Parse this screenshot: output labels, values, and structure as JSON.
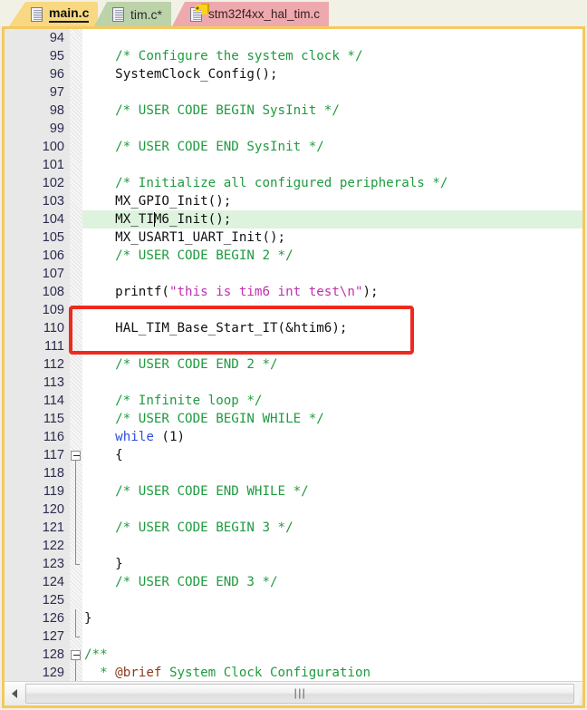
{
  "window": {
    "accent_border": "#f5c960",
    "background": "#ffffff"
  },
  "tabs": [
    {
      "label": "main.c",
      "icon": "document-icon",
      "state": "active",
      "color": "#f8d880",
      "modified": false
    },
    {
      "label": "tim.c*",
      "icon": "document-icon",
      "state": "modified",
      "color": "#bcd3aa",
      "modified": true
    },
    {
      "label": "stm32f4xx_hal_tim.c",
      "icon": "document-locked-icon",
      "state": "read-only",
      "color": "#eda9ae",
      "modified": false
    }
  ],
  "editor": {
    "language": "c",
    "current_line": 104,
    "caret_line": 104,
    "caret_column": 8,
    "first_visible_line": 94,
    "last_visible_line": 129,
    "highlight_color": "#ddf3dd",
    "annotation": {
      "type": "red-rectangle",
      "color": "#ee2a1e",
      "covers_lines": [
        109,
        110,
        111
      ]
    },
    "lines": [
      {
        "num": "94",
        "text": "",
        "fold": "none"
      },
      {
        "num": "95",
        "text": "    /* Configure the system clock */",
        "fold": "none"
      },
      {
        "num": "96",
        "text": "    SystemClock_Config();",
        "fold": "none"
      },
      {
        "num": "97",
        "text": "",
        "fold": "none"
      },
      {
        "num": "98",
        "text": "    /* USER CODE BEGIN SysInit */",
        "fold": "none"
      },
      {
        "num": "99",
        "text": "",
        "fold": "none"
      },
      {
        "num": "100",
        "text": "    /* USER CODE END SysInit */",
        "fold": "none"
      },
      {
        "num": "101",
        "text": "",
        "fold": "none"
      },
      {
        "num": "102",
        "text": "    /* Initialize all configured peripherals */",
        "fold": "none"
      },
      {
        "num": "103",
        "text": "    MX_GPIO_Init();",
        "fold": "none"
      },
      {
        "num": "104",
        "text": "    MX_TIM6_Init();",
        "fold": "none"
      },
      {
        "num": "105",
        "text": "    MX_USART1_UART_Init();",
        "fold": "none"
      },
      {
        "num": "106",
        "text": "    /* USER CODE BEGIN 2 */",
        "fold": "none"
      },
      {
        "num": "107",
        "text": "",
        "fold": "none"
      },
      {
        "num": "108",
        "text": "    printf(\"this is tim6 int test\\n\");",
        "fold": "none"
      },
      {
        "num": "109",
        "text": "",
        "fold": "none"
      },
      {
        "num": "110",
        "text": "    HAL_TIM_Base_Start_IT(&htim6);",
        "fold": "none"
      },
      {
        "num": "111",
        "text": "",
        "fold": "none"
      },
      {
        "num": "112",
        "text": "    /* USER CODE END 2 */",
        "fold": "none"
      },
      {
        "num": "113",
        "text": "",
        "fold": "none"
      },
      {
        "num": "114",
        "text": "    /* Infinite loop */",
        "fold": "none"
      },
      {
        "num": "115",
        "text": "    /* USER CODE BEGIN WHILE */",
        "fold": "none"
      },
      {
        "num": "116",
        "text": "    while (1)",
        "fold": "none"
      },
      {
        "num": "117",
        "text": "    {",
        "fold": "start"
      },
      {
        "num": "118",
        "text": "",
        "fold": "line"
      },
      {
        "num": "119",
        "text": "    /* USER CODE END WHILE */",
        "fold": "line"
      },
      {
        "num": "120",
        "text": "",
        "fold": "line"
      },
      {
        "num": "121",
        "text": "    /* USER CODE BEGIN 3 */",
        "fold": "line"
      },
      {
        "num": "122",
        "text": "",
        "fold": "line"
      },
      {
        "num": "123",
        "text": "    }",
        "fold": "end"
      },
      {
        "num": "124",
        "text": "    /* USER CODE END 3 */",
        "fold": "none"
      },
      {
        "num": "125",
        "text": "",
        "fold": "none"
      },
      {
        "num": "126",
        "text": "}",
        "fold": "line2"
      },
      {
        "num": "127",
        "text": "",
        "fold": "end2"
      },
      {
        "num": "128",
        "text": "/**",
        "fold": "start"
      },
      {
        "num": "129",
        "text": "  * @brief System Clock Configuration",
        "fold": "line"
      }
    ]
  },
  "scrollbar": {
    "orientation": "horizontal",
    "left_arrow": "scroll-left-arrow-icon",
    "grip": "scrollbar-grip-icon",
    "thumb_position_percent": 0
  }
}
